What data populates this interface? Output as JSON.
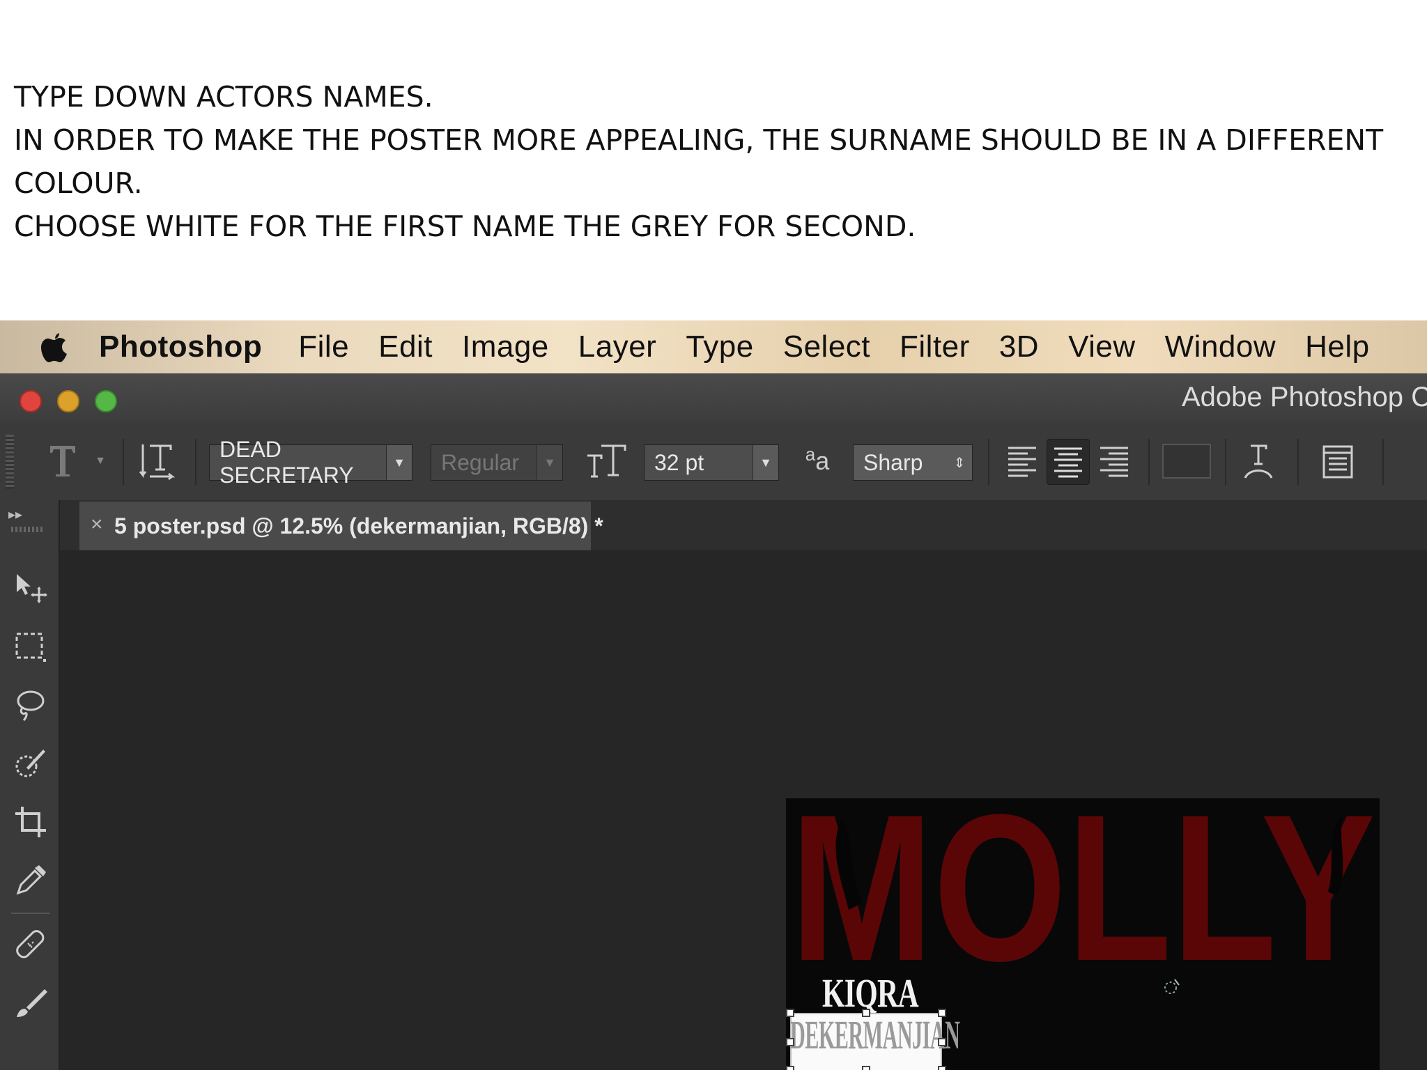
{
  "instructions": {
    "line1": "TYPE DOWN ACTORS NAMES.",
    "line2": "IN ORDER TO MAKE THE POSTER MORE APPEALING, THE SURNAME SHOULD BE IN A DIFFERENT COLOUR.",
    "line3": "CHOOSE WHITE FOR THE FIRST NAME THE GREY FOR SECOND."
  },
  "menubar": {
    "app_name": "Photoshop",
    "items": [
      "File",
      "Edit",
      "Image",
      "Layer",
      "Type",
      "Select",
      "Filter",
      "3D",
      "View",
      "Window",
      "Help"
    ]
  },
  "window": {
    "title": "Adobe Photoshop C"
  },
  "options_bar": {
    "font_family": "DEAD SECRETARY",
    "font_style": "Regular",
    "font_size": "32 pt",
    "aa_label": "a",
    "aa_sub": "a",
    "antialias": "Sharp"
  },
  "document_tab": {
    "label": "5 poster.psd @ 12.5% (dekermanjian, RGB/8) *"
  },
  "poster": {
    "title": "MOLLY",
    "first_name": "KIQRA",
    "last_name": "DEKERMANJIAN"
  },
  "colors": {
    "poster_title": "#5a0606",
    "first_name": "#f2f2f2",
    "last_name": "#9a9a9a",
    "canvas_bg": "#262626"
  }
}
